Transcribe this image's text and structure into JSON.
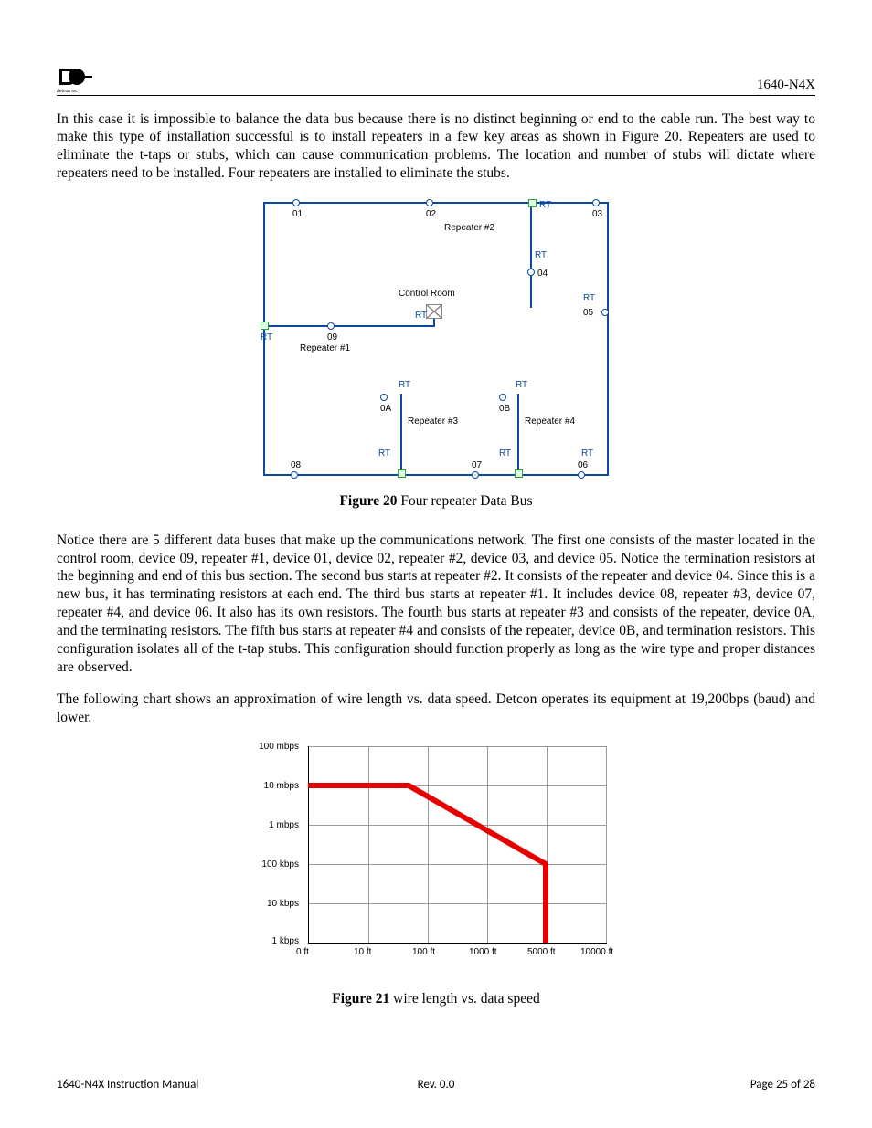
{
  "header": {
    "doc_id": "1640-N4X",
    "logo_text": "DC",
    "logo_sub": "detcon inc"
  },
  "paragraphs": {
    "p1": "In this case it is impossible to balance the data bus because there is no distinct beginning or end to the cable run.  The best way to make this type of installation successful is to install repeaters in a few key areas as shown in Figure 20.  Repeaters are used to eliminate the t-taps or stubs, which can cause communication problems.  The location and number of stubs will dictate where repeaters need to be installed.  Four repeaters are installed to eliminate the stubs.",
    "p2": "Notice there are 5 different data buses that make up the communications network.  The first one consists of the master located in the control room, device 09, repeater #1, device 01, device 02, repeater #2, device 03, and device 05.  Notice the termination resistors at the beginning and end of this bus section.  The second bus starts at repeater #2.  It consists of the repeater and device 04. Since this is a new bus, it has terminating resistors at each end.  The third bus starts at repeater #1.  It includes device 08, repeater #3, device 07, repeater #4, and device 06. It also has its own resistors.  The fourth bus starts at repeater #3 and consists of the repeater, device 0A, and the terminating resistors.  The fifth bus starts at repeater #4 and consists of the repeater, device 0B, and termination resistors.  This configuration isolates all of the t-tap stubs.  This configuration should function properly as long as the wire type and proper distances are observed.",
    "p3": "The following chart shows an approximation of wire length vs. data speed.  Detcon operates its equipment at 19,200bps (baud) and lower."
  },
  "figures": {
    "f20_label": "Figure 20",
    "f20_caption": " Four repeater Data Bus",
    "f21_label": "Figure 21",
    "f21_caption": " wire length vs. data speed"
  },
  "diagram20": {
    "control_room": "Control Room",
    "rt": "RT",
    "nodes": {
      "n01": "01",
      "n02": "02",
      "n03": "03",
      "n04": "04",
      "n05": "05",
      "n06": "06",
      "n07": "07",
      "n08": "08",
      "n09": "09",
      "n0a": "0A",
      "n0b": "0B"
    },
    "repeaters": {
      "r1": "Repeater #1",
      "r2": "Repeater #2",
      "r3": "Repeater #3",
      "r4": "Repeater #4"
    }
  },
  "chart_data": {
    "type": "line",
    "title": "",
    "xlabel": "",
    "ylabel": "",
    "x_ticks": [
      "0 ft",
      "10 ft",
      "100 ft",
      "1000 ft",
      "5000 ft",
      "10000 ft"
    ],
    "y_ticks": [
      "1 kbps",
      "10 kbps",
      "100 kbps",
      "1 mbps",
      "10 mbps",
      "100 mbps"
    ],
    "x_positions": [
      0,
      10,
      100,
      1000,
      5000,
      10000
    ],
    "series": [
      {
        "name": "speed_vs_length",
        "points": [
          {
            "x_ft": 0,
            "y": "10 mbps"
          },
          {
            "x_ft": 65,
            "y": "10 mbps"
          },
          {
            "x_ft": 5000,
            "y": "100 kbps"
          },
          {
            "x_ft": 5000,
            "y": "1 kbps"
          }
        ]
      }
    ]
  },
  "footer": {
    "left": "1640-N4X Instruction Manual",
    "mid": "Rev. 0.0",
    "right": "Page 25 of 28"
  }
}
